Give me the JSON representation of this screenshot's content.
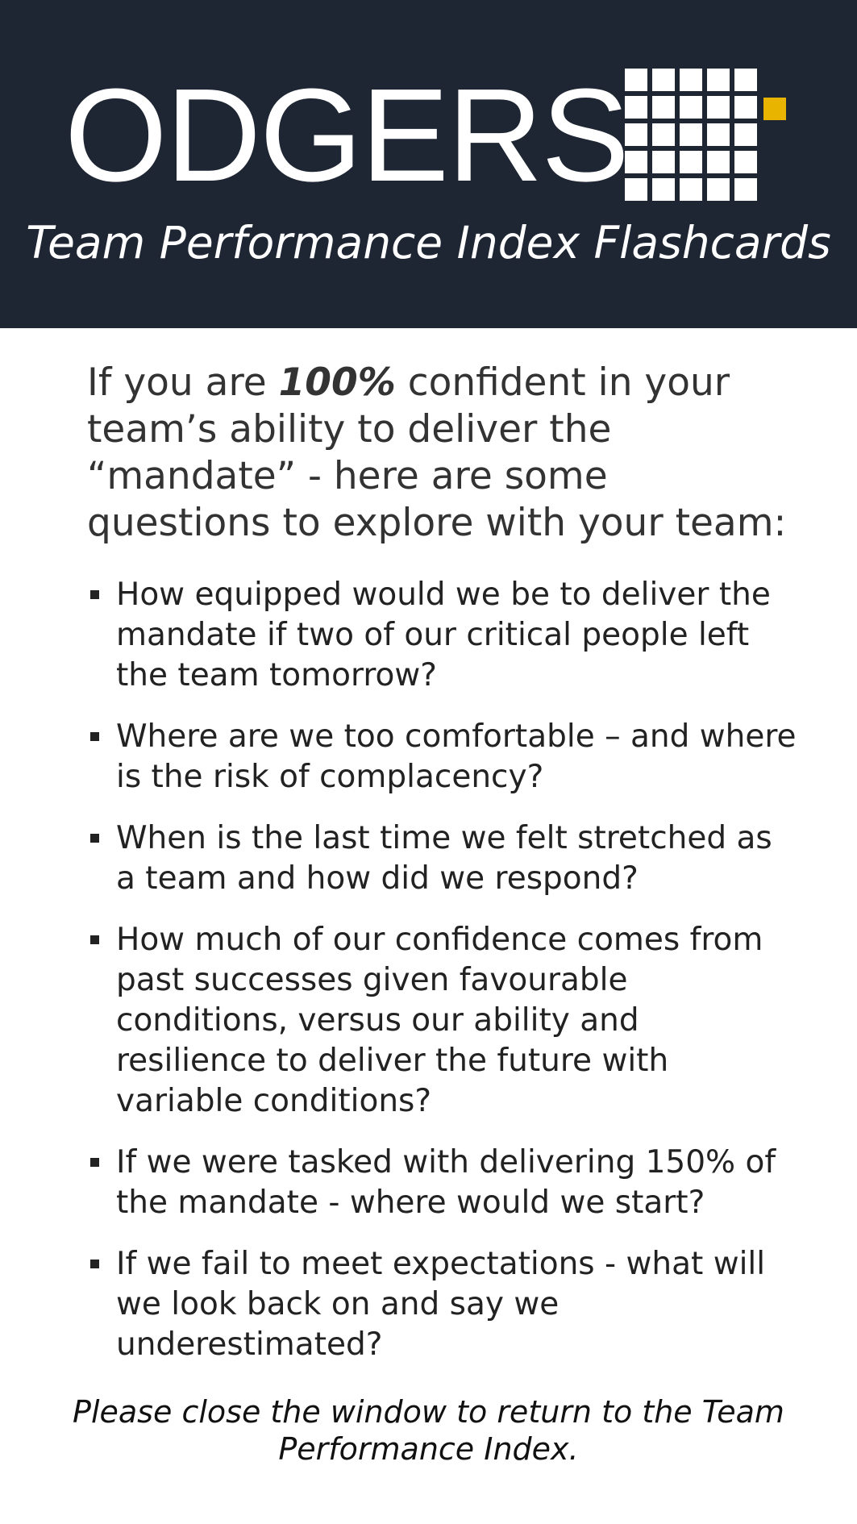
{
  "header": {
    "logo_text": "ODGERS",
    "subtitle": "Team Performance Index Flashcards",
    "colors": {
      "background": "#1f2633",
      "logo": "#ffffff",
      "accent": "#e8b400"
    }
  },
  "intro": {
    "before": "If you are ",
    "emphasis": "100%",
    "after": " confident in your team’s ability to deliver the “mandate” - here are some questions to explore with your team:"
  },
  "questions": [
    "How equipped would we be to deliver the mandate if two of our critical people left the team tomorrow?",
    "Where are we too comfortable – and where is the risk of complacency?",
    "When is the last time we felt stretched as a team and how did we respond?",
    "How much of our confidence comes from past successes given favourable conditions, versus our ability and resilience to deliver the future with variable conditions?",
    "If we were tasked with delivering 150% of the mandate - where would we start?",
    "If we fail to meet expectations - what will we look back on and say we underestimated?"
  ],
  "closing": "Please close the window to return to the Team Performance Index."
}
